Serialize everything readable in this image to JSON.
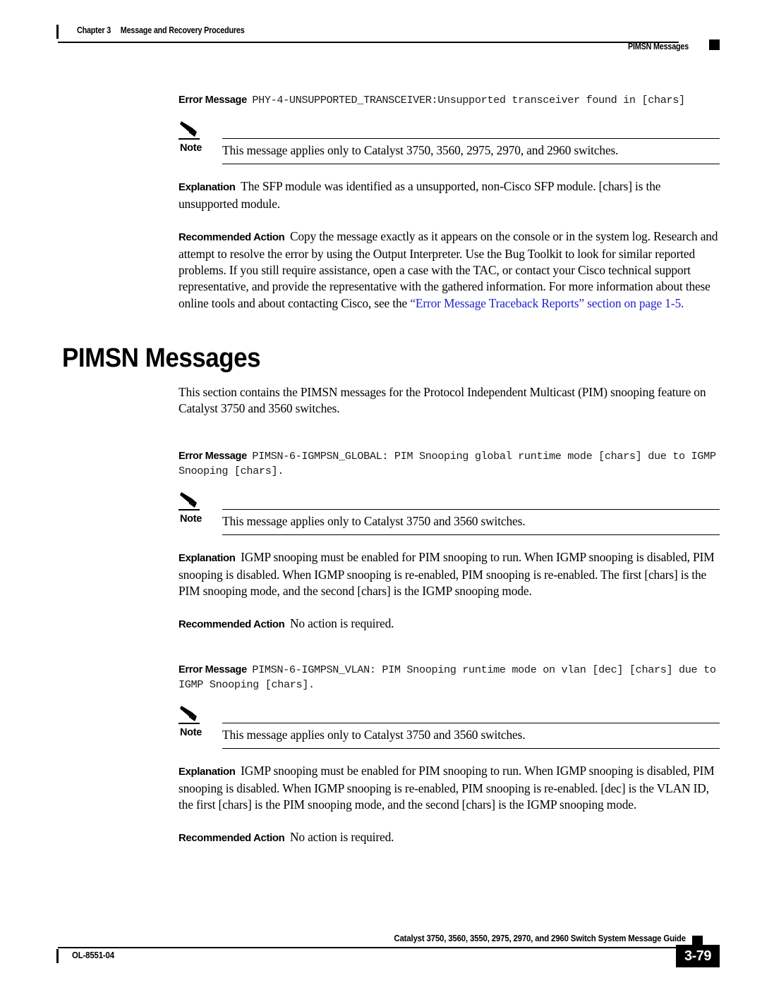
{
  "header": {
    "chapter_number": "Chapter 3",
    "chapter_title": "Message and Recovery Procedures",
    "section": "PIMSN Messages"
  },
  "labels": {
    "error_message": "Error Message",
    "note": "Note",
    "explanation": "Explanation",
    "recommended_action": "Recommended Action"
  },
  "heading": "PIMSN Messages",
  "intro_paragraph": "This section contains the PIMSN messages for the Protocol Independent Multicast (PIM) snooping feature on Catalyst 3750 and 3560 switches.",
  "messages": [
    {
      "code": "PHY-4-UNSUPPORTED_TRANSCEIVER:Unsupported transceiver found in [chars]",
      "note": "This message applies only to Catalyst 3750, 3560, 2975, 2970, and 2960 switches.",
      "explanation": "The SFP module was identified as a unsupported, non-Cisco SFP module. [chars] is the unsupported module.",
      "recommended_action_text": "Copy the message exactly as it appears on the console or in the system log. Research and attempt to resolve the error by using the Output Interpreter. Use the Bug Toolkit to look for similar reported problems. If you still require assistance, open a case with the TAC, or contact your Cisco technical support representative, and provide the representative with the gathered information. For more information about these online tools and about contacting Cisco, see the ",
      "recommended_action_link": "“Error Message Traceback Reports” section on page 1-5."
    },
    {
      "code": "PIMSN-6-IGMPSN_GLOBAL: PIM Snooping global runtime mode [chars] due to IGMP Snooping [chars].",
      "note": "This message applies only to Catalyst 3750 and 3560 switches.",
      "explanation": "IGMP snooping must be enabled for PIM snooping to run. When IGMP snooping is disabled, PIM snooping is disabled. When IGMP snooping is re-enabled, PIM snooping is re-enabled. The first [chars] is the PIM snooping mode, and the second [chars] is the IGMP snooping mode.",
      "recommended_action_text": "No action is required."
    },
    {
      "code": "PIMSN-6-IGMPSN_VLAN: PIM Snooping runtime mode on vlan [dec] [chars] due to IGMP Snooping [chars].",
      "note": "This message applies only to Catalyst 3750 and 3560 switches.",
      "explanation": "IGMP snooping must be enabled for PIM snooping to run. When IGMP snooping is disabled, PIM snooping is disabled. When IGMP snooping is re-enabled, PIM snooping is re-enabled. [dec] is the VLAN ID, the first [chars] is the PIM snooping mode, and the second [chars] is the IGMP snooping mode.",
      "recommended_action_text": "No action is required."
    }
  ],
  "footer": {
    "doc_id": "OL-8551-04",
    "guide_title": "Catalyst 3750, 3560, 3550, 2975, 2970, and 2960 Switch System Message Guide",
    "page_number": "3-79"
  },
  "colors": {
    "link": "#2222cc",
    "text": "#000000",
    "code": "#1a1a1a"
  }
}
